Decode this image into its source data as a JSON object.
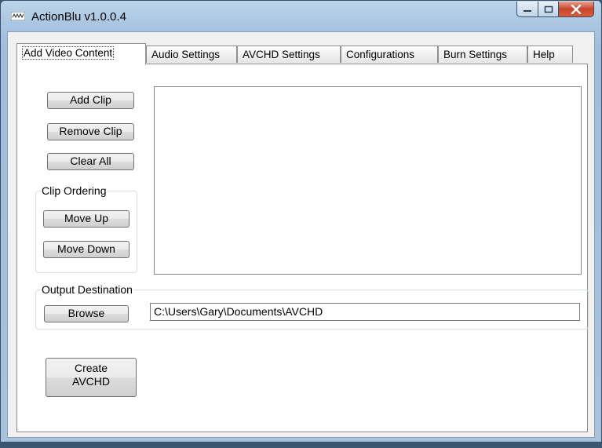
{
  "window": {
    "title": "ActionBlu v1.0.0.4",
    "controls": {
      "minimize": "minimize",
      "maximize": "maximize",
      "close": "close"
    }
  },
  "tabs": [
    {
      "label": "Add Video Content",
      "active": true
    },
    {
      "label": "Audio Settings",
      "active": false
    },
    {
      "label": "AVCHD Settings",
      "active": false
    },
    {
      "label": "Configurations",
      "active": false
    },
    {
      "label": "Burn Settings",
      "active": false
    },
    {
      "label": "Help",
      "active": false
    }
  ],
  "clips": {
    "add_label": "Add Clip",
    "remove_label": "Remove Clip",
    "clear_label": "Clear All",
    "items": []
  },
  "ordering": {
    "title": "Clip Ordering",
    "up_label": "Move Up",
    "down_label": "Move Down"
  },
  "output": {
    "title": "Output Destination",
    "browse_label": "Browse",
    "path": "C:\\Users\\Gary\\Documents\\AVCHD"
  },
  "create": {
    "line1": "Create",
    "line2": "AVCHD"
  },
  "colors": {
    "close_button": "#c8452a",
    "title_bar": "#a9c6e2",
    "panel_bg": "#ffffff"
  }
}
